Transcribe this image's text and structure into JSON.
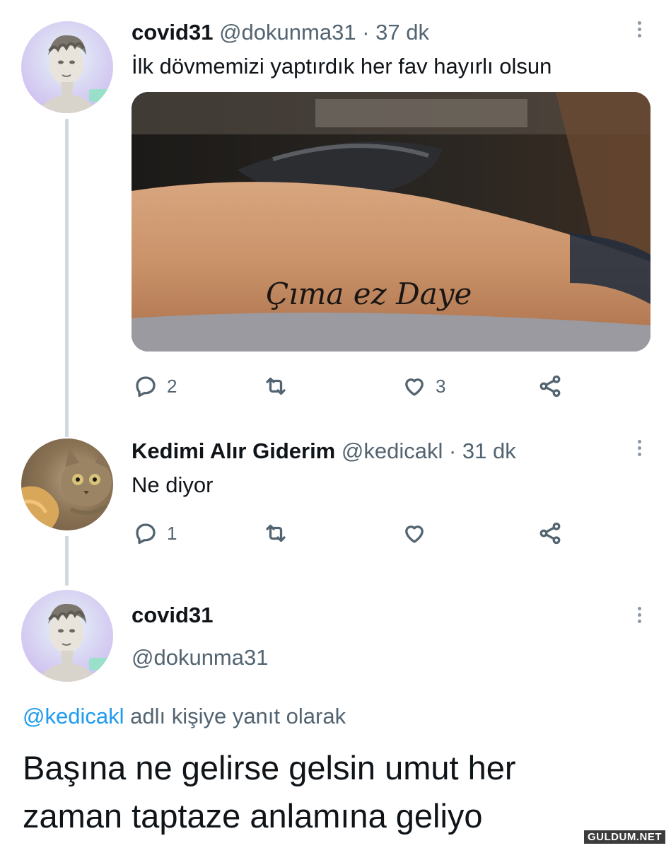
{
  "tweet1": {
    "display_name": "covid31",
    "handle": "@dokunma31",
    "separator": "·",
    "time": "37 dk",
    "text": "İlk dövmemizi yaptırdık her fav hayırlı olsun",
    "photo_tattoo_text": "Çıma ez Daye",
    "replies": "2",
    "retweets": "",
    "likes": "3"
  },
  "tweet2": {
    "display_name": "Kedimi Alır Giderim",
    "handle": "@kedicakl",
    "separator": "·",
    "time": "31 dk",
    "text": "Ne diyor",
    "replies": "1",
    "retweets": "",
    "likes": ""
  },
  "tweet3": {
    "display_name": "covid31",
    "handle": "@dokunma31",
    "reply_mention": "@kedicakl",
    "reply_suffix": "adlı kişiye yanıt olarak",
    "text_line1": "Başına ne gelirse gelsin umut her",
    "text_line2": "zaman taptaze anlamına geliyo"
  },
  "watermark": "GULDUM.NET",
  "colors": {
    "text": "#0f1419",
    "secondary": "#536471",
    "link": "#1d9bf0",
    "thread_line": "#cfd9de"
  },
  "icons": [
    "reply-icon",
    "retweet-icon",
    "like-icon",
    "share-icon",
    "more-icon"
  ]
}
